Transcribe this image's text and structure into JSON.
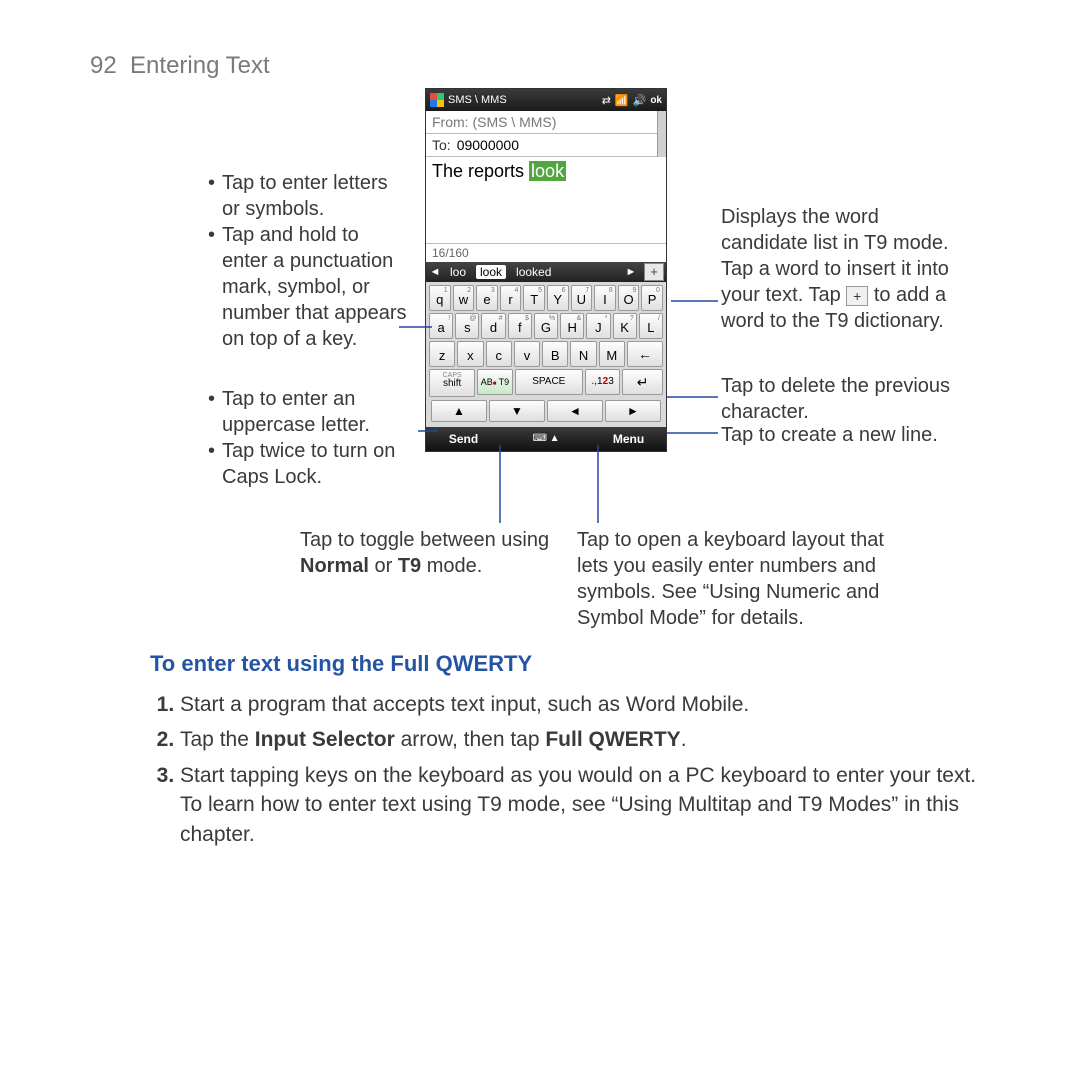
{
  "page": {
    "number": "92",
    "title": "Entering Text"
  },
  "phone": {
    "titlebar": {
      "app": "SMS \\ MMS",
      "ok": "ok"
    },
    "from": "From: (SMS \\ MMS)",
    "to_label": "To:",
    "to_value": "09000000",
    "message_pre": "The reports ",
    "message_hl": "look",
    "char_count": "16/160",
    "candidates": {
      "left": "loo",
      "selected": "look",
      "right": "looked"
    },
    "rows": {
      "r1": [
        {
          "k": "q",
          "s": "1"
        },
        {
          "k": "w",
          "s": "2"
        },
        {
          "k": "e",
          "s": "3"
        },
        {
          "k": "r",
          "s": "4"
        },
        {
          "k": "T",
          "s": "5"
        },
        {
          "k": "Y",
          "s": "6"
        },
        {
          "k": "U",
          "s": "7"
        },
        {
          "k": "I",
          "s": "8"
        },
        {
          "k": "O",
          "s": "9"
        },
        {
          "k": "P",
          "s": "0"
        }
      ],
      "r2": [
        {
          "k": "a",
          "s": "!"
        },
        {
          "k": "s",
          "s": "@"
        },
        {
          "k": "d",
          "s": "#"
        },
        {
          "k": "f",
          "s": "$"
        },
        {
          "k": "G",
          "s": "%"
        },
        {
          "k": "H",
          "s": "&"
        },
        {
          "k": "J",
          "s": "*"
        },
        {
          "k": "K",
          "s": "?"
        },
        {
          "k": "L",
          "s": "/"
        }
      ],
      "r3": [
        {
          "k": "z"
        },
        {
          "k": "x"
        },
        {
          "k": "c"
        },
        {
          "k": "v"
        },
        {
          "k": "B"
        },
        {
          "k": "N"
        },
        {
          "k": "M"
        }
      ],
      "shift_top": "CAPS",
      "shift_bot": "shift",
      "t9": "AB T9",
      "space": "SPACE",
      "num": ".,123",
      "bksp": "←",
      "enter": "↵"
    },
    "nav": [
      "▲",
      "▼",
      "◄",
      "►"
    ],
    "soft": {
      "left": "Send",
      "mid": "⌨ ▲",
      "right": "Menu"
    }
  },
  "callouts": {
    "left1": "Tap to enter letters or symbols.",
    "left2": "Tap and hold to enter a punctuation mark, symbol, or number that appears on top of a key.",
    "left3": "Tap to enter an uppercase letter.",
    "left4": "Tap twice to turn on Caps Lock.",
    "right1a": "Displays the word candidate list in T9 mode. Tap a word to insert it into your text. Tap ",
    "right1b": " to add a word to the T9 dictionary.",
    "right2": "Tap to delete the previous character.",
    "right3": "Tap to create a new line.",
    "bottomL": "Tap to toggle between using ",
    "bottomL_b1": "Normal",
    "bottomL_mid": " or ",
    "bottomL_b2": "T9",
    "bottomL_end": " mode.",
    "bottomR": "Tap to open a keyboard layout that lets you easily enter numbers and symbols. See “Using Numeric and Symbol Mode” for details."
  },
  "section_heading": "To enter text using the Full QWERTY",
  "steps": {
    "s1": "Start a program that accepts text input, such as Word Mobile.",
    "s2a": "Tap the ",
    "s2b": "Input Selector",
    "s2c": " arrow, then tap ",
    "s2d": "Full QWERTY",
    "s2e": ".",
    "s3": "Start tapping keys on the keyboard as you would on a PC keyboard to enter your text. To learn how to enter text using T9 mode, see “Using Multitap and T9 Modes” in this chapter."
  }
}
